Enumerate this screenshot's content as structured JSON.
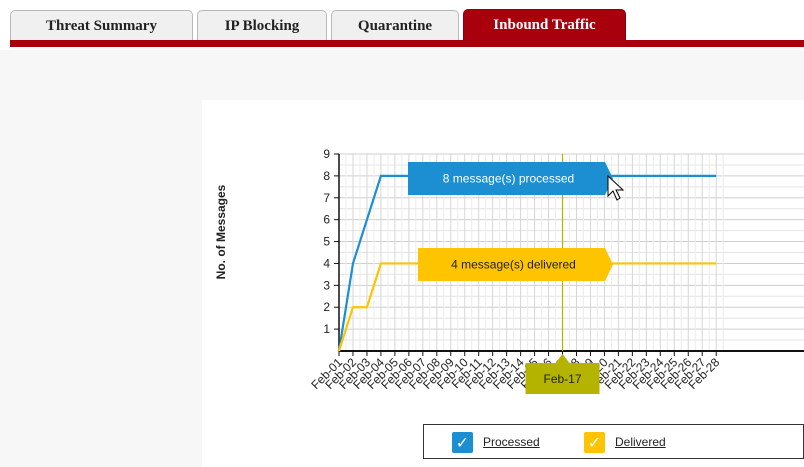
{
  "tabs": [
    {
      "label": "Threat Summary",
      "active": false
    },
    {
      "label": "IP Blocking",
      "active": false
    },
    {
      "label": "Quarantine",
      "active": false
    },
    {
      "label": "Inbound Traffic",
      "active": true
    }
  ],
  "colors": {
    "brand": "#a8000d",
    "processed": "#1b8fd2",
    "delivered": "#ffc400",
    "crosshair": "#b4b400",
    "crosshair_tooltip": "#b4b400"
  },
  "chart_data": {
    "type": "line",
    "ylabel": "No. of Messages",
    "ylim": [
      0,
      9
    ],
    "yticks": [
      1,
      2,
      3,
      4,
      5,
      6,
      7,
      8,
      9
    ],
    "grid": true,
    "legend_position": "bottom",
    "x": [
      "Feb-01",
      "Feb-02",
      "Feb-03",
      "Feb-04",
      "Feb-05",
      "Feb-06",
      "Feb-07",
      "Feb-08",
      "Feb-09",
      "Feb-10",
      "Feb-11",
      "Feb-12",
      "Feb-13",
      "Feb-14",
      "Feb-15",
      "Feb-16",
      "Feb-17",
      "Feb-18",
      "Feb-19",
      "Feb-20",
      "Feb-21",
      "Feb-22",
      "Feb-23",
      "Feb-24",
      "Feb-25",
      "Feb-26",
      "Feb-27",
      "Feb-28"
    ],
    "series": [
      {
        "name": "Processed",
        "color": "#1b8fd2",
        "values": [
          0,
          4,
          6,
          8,
          8,
          8,
          8,
          8,
          8,
          8,
          8,
          8,
          8,
          8,
          8,
          8,
          8,
          8,
          8,
          8,
          8,
          8,
          8,
          8,
          8,
          8,
          8,
          8
        ]
      },
      {
        "name": "Delivered",
        "color": "#ffc400",
        "values": [
          0,
          2,
          2,
          4,
          4,
          4,
          4,
          4,
          4,
          4,
          4,
          4,
          4,
          4,
          4,
          4,
          4,
          4,
          4,
          4,
          4,
          4,
          4,
          4,
          4,
          4,
          4,
          4
        ]
      }
    ],
    "crosshair": {
      "x": "Feb-17"
    },
    "tooltips": {
      "processed": "8 message(s) processed",
      "delivered": "4 message(s) delivered",
      "x": "Feb-17"
    }
  },
  "legend": {
    "items": [
      {
        "label": "Processed",
        "checked": true,
        "color": "#1b8fd2"
      },
      {
        "label": "Delivered",
        "checked": true,
        "color": "#ffc400"
      }
    ]
  }
}
